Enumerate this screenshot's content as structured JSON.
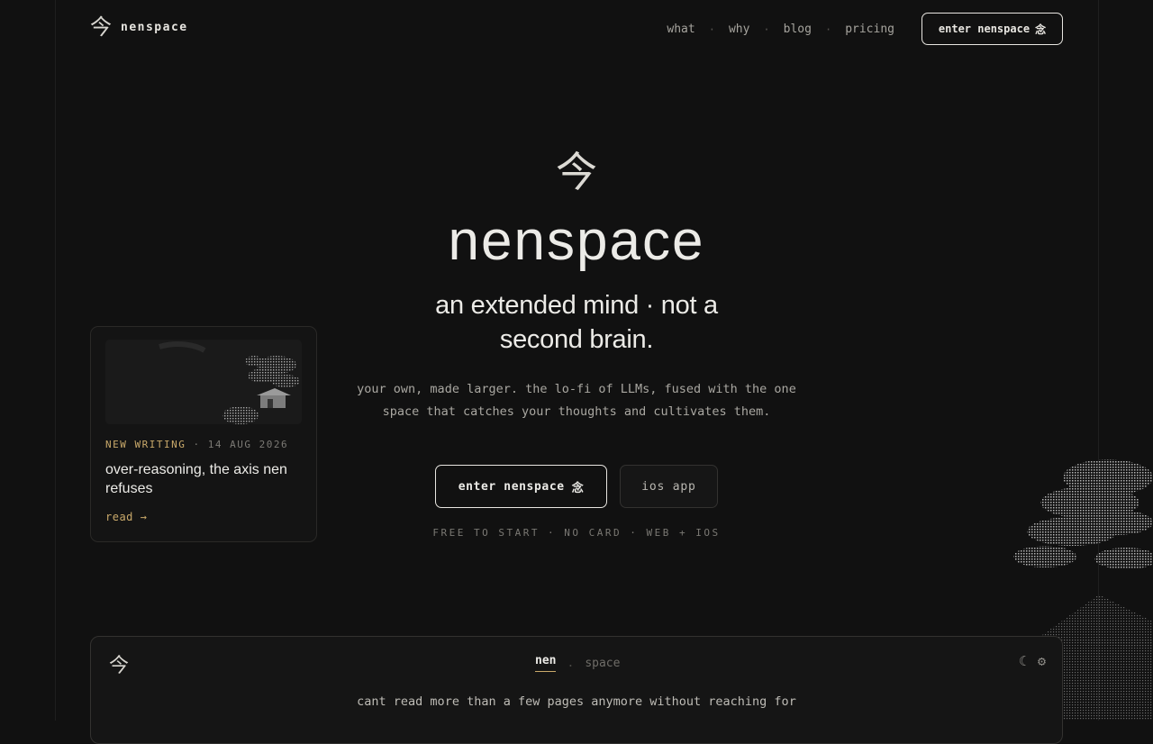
{
  "header": {
    "brand_glyph": "今",
    "brand_name": "nenspace",
    "nav": [
      "what",
      "why",
      "blog",
      "pricing"
    ],
    "nav_separator": "·",
    "cta_label": "enter nenspace",
    "cta_glyph": "念"
  },
  "hero": {
    "mark": "今",
    "title": "nenspace",
    "subtitle": "an extended mind · not a second brain.",
    "description": "your own, made larger. the lo-fi of LLMs, fused with the one space that catches your thoughts and cultivates them.",
    "primary_label": "enter nenspace",
    "primary_glyph": "念",
    "secondary_label": "ios app",
    "fine_print": "FREE TO START · NO CARD · WEB + IOS"
  },
  "writing_card": {
    "tag": "NEW WRITING",
    "separator": "·",
    "date": "14 AUG 2026",
    "title": "over-reasoning, the axis nen refuses",
    "link": "read →"
  },
  "panel": {
    "glyph": "今",
    "tabs": [
      "nen",
      "space"
    ],
    "active_tab": "nen",
    "tab_separator": ".",
    "icons": [
      "moon-icon",
      "gear-icon"
    ],
    "text": "cant read more than a few pages anymore without reaching for"
  },
  "colors": {
    "background": "#111111",
    "text": "#ecebe7",
    "accent": "#c9a96a",
    "muted": "#7a7873"
  }
}
